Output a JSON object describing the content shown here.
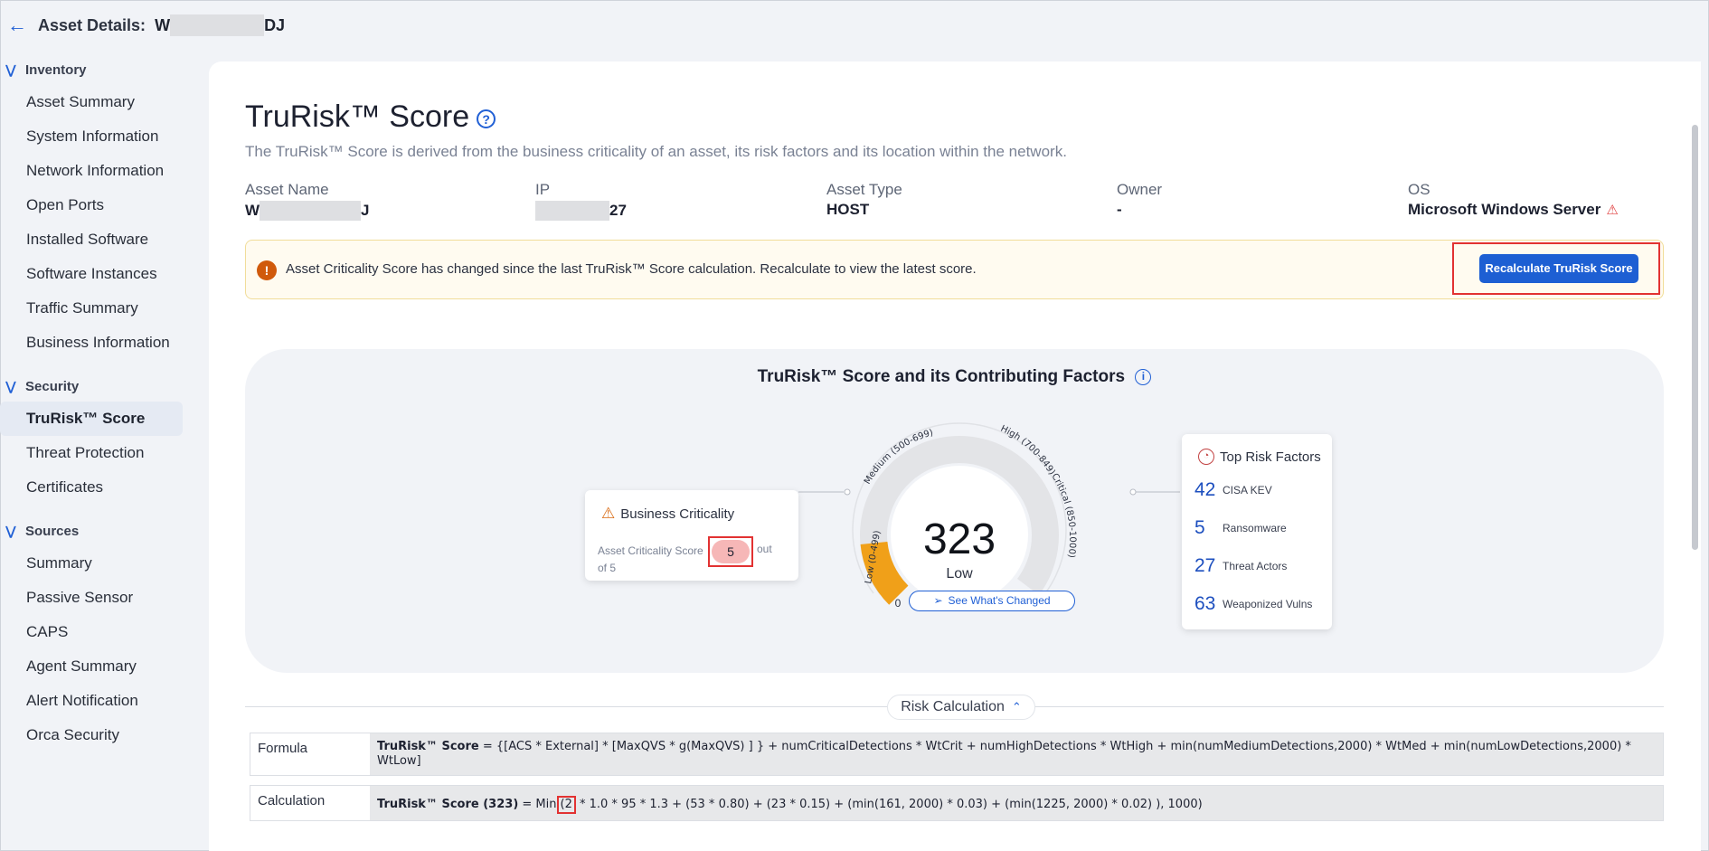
{
  "header": {
    "title": "Asset Details:",
    "asset_prefix": "W",
    "asset_suffix": "DJ"
  },
  "sidebar": {
    "sections": [
      {
        "label": "Inventory",
        "items": [
          "Asset Summary",
          "System Information",
          "Network Information",
          "Open Ports",
          "Installed Software",
          "Software Instances",
          "Traffic Summary",
          "Business Information"
        ]
      },
      {
        "label": "Security",
        "items": [
          "TruRisk™ Score",
          "Threat Protection",
          "Certificates"
        ]
      },
      {
        "label": "Sources",
        "items": [
          "Summary",
          "Passive Sensor",
          "CAPS",
          "Agent Summary",
          "Alert Notification",
          "Orca Security"
        ]
      }
    ],
    "active_item": "TruRisk™ Score"
  },
  "page": {
    "title": "TruRisk™ Score",
    "subtitle": "The TruRisk™ Score is derived from the business criticality of an asset, its risk factors and its location within the network."
  },
  "meta": {
    "asset_name_label": "Asset Name",
    "asset_name_prefix": "W",
    "asset_name_suffix": "J",
    "ip_label": "IP",
    "ip_suffix": "27",
    "asset_type_label": "Asset Type",
    "asset_type_value": "HOST",
    "owner_label": "Owner",
    "owner_value": "-",
    "os_label": "OS",
    "os_value": "Microsoft Windows Server"
  },
  "alert": {
    "message": "Asset Criticality Score has changed since the last TruRisk™ Score calculation. Recalculate to view the latest score.",
    "button_label": "Recalculate TruRisk Score"
  },
  "score_card": {
    "title": "TruRisk™ Score and its Contributing Factors",
    "business_criticality": {
      "title": "Business Criticality",
      "prefix": "Asset Criticality Score",
      "value": "5",
      "out": "out",
      "of_text": "of 5"
    },
    "gauge": {
      "score": "323",
      "label": "Low",
      "min_label": "0",
      "max_label": "1000",
      "band_low": "Low (0-499)",
      "band_medium": "Medium (500-699)",
      "band_high": "High (700-849)",
      "band_critical": "Critical (850-1000)",
      "value_fraction": 0.323,
      "accent_color": "#f0a019"
    },
    "top_risk_factors": {
      "title": "Top Risk Factors",
      "items": [
        {
          "count": "42",
          "label": "CISA KEV"
        },
        {
          "count": "5",
          "label": "Ransomware"
        },
        {
          "count": "27",
          "label": "Threat Actors"
        },
        {
          "count": "63",
          "label": "Weaponized Vulns"
        }
      ]
    },
    "see_changed_label": "See What's Changed"
  },
  "risk_calculation": {
    "toggle_label": "Risk Calculation",
    "formula_label": "Formula",
    "formula_bold": "TruRisk™ Score",
    "formula_text": " = {[ACS * External] * [MaxQVS * g(MaxQVS) ] } + numCriticalDetections * WtCrit + numHighDetections * WtHigh + min(numMediumDetections,2000) * WtMed + min(numLowDetections,2000) * WtLow]",
    "calculation_label": "Calculation",
    "calc_bold": "TruRisk™ Score (323)",
    "calc_prefix": " = Min",
    "calc_highlight": "(2",
    "calc_rest": " * 1.0 * 95 * 1.3 + (53 * 0.80) + (23 * 0.15) + (min(161, 2000) * 0.03) + (min(1225, 2000) * 0.02) ), 1000)"
  }
}
